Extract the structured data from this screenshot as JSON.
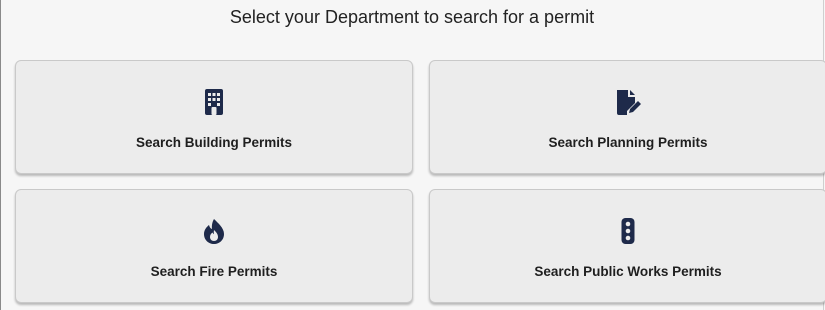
{
  "page": {
    "heading": "Select your Department to search for a permit"
  },
  "cards": [
    {
      "label": "Search Building Permits",
      "icon": "building-icon"
    },
    {
      "label": "Search Planning Permits",
      "icon": "file-pen-icon"
    },
    {
      "label": "Search Fire Permits",
      "icon": "fire-icon"
    },
    {
      "label": "Search Public Works Permits",
      "icon": "traffic-light-icon"
    }
  ],
  "colors": {
    "background": "#f6f6f6",
    "card_background": "#ececec",
    "icon": "#1e2a4a",
    "text": "#1f1f1f"
  }
}
